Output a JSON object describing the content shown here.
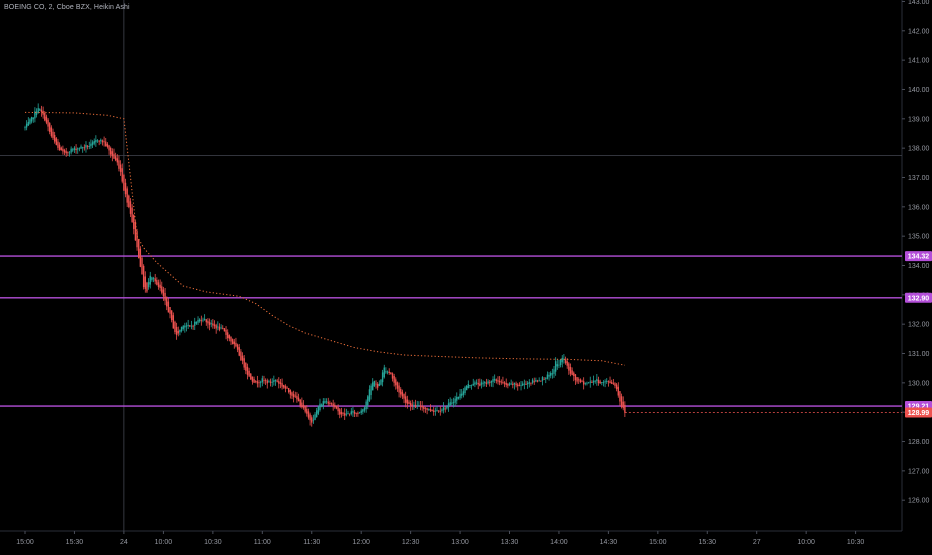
{
  "legend": {
    "symbol_line": "BOEING CO, 2, Cboe BZX, Heikin Ashi"
  },
  "colors": {
    "background": "#000000",
    "up": "#26a69a",
    "down": "#ef5350",
    "ma": "#f0703a",
    "level": "#b44fd9",
    "last_price": "#ef5350",
    "axis_text": "#9598a1",
    "crosshair": "#434651"
  },
  "chart_data": {
    "type": "candlestick",
    "title": "BOEING CO, 2, Cboe BZX, Heikin Ashi",
    "ylim": [
      124.95,
      143.05
    ],
    "y_ticks": [
      "126.00",
      "127.00",
      "128.00",
      "129.00",
      "130.00",
      "131.00",
      "132.00",
      "133.00",
      "134.00",
      "135.00",
      "136.00",
      "137.00",
      "138.00",
      "139.00",
      "140.00",
      "141.00",
      "142.00",
      "143.00"
    ],
    "time_range": [
      "15:00",
      "10:55 (day 27)"
    ],
    "x_ticks": [
      {
        "label": "15:00",
        "t": 0
      },
      {
        "label": "15:30",
        "t": 30
      },
      {
        "label": "24",
        "t": 60
      },
      {
        "label": "10:00",
        "t": 84
      },
      {
        "label": "10:30",
        "t": 114
      },
      {
        "label": "11:00",
        "t": 144
      },
      {
        "label": "11:30",
        "t": 174
      },
      {
        "label": "12:00",
        "t": 204
      },
      {
        "label": "12:30",
        "t": 234
      },
      {
        "label": "13:00",
        "t": 264
      },
      {
        "label": "13:30",
        "t": 294
      },
      {
        "label": "14:00",
        "t": 324
      },
      {
        "label": "14:30",
        "t": 354
      },
      {
        "label": "15:00",
        "t": 384
      },
      {
        "label": "15:30",
        "t": 414
      },
      {
        "label": "27",
        "t": 444
      },
      {
        "label": "10:00",
        "t": 474
      },
      {
        "label": "10:30",
        "t": 504
      }
    ],
    "session_break_t": 60,
    "crosshair_price": 137.75,
    "horizontal_levels": [
      {
        "value": 134.32,
        "label": "134.32"
      },
      {
        "value": 132.9,
        "label": "132.90"
      },
      {
        "value": 129.21,
        "label": "129.21"
      }
    ],
    "last_price": {
      "value": 128.99,
      "label": "128.99"
    },
    "price_path": [
      [
        0,
        138.7
      ],
      [
        4,
        139.0
      ],
      [
        8,
        139.4
      ],
      [
        12,
        139.0
      ],
      [
        16,
        138.4
      ],
      [
        20,
        138.0
      ],
      [
        24,
        137.8
      ],
      [
        28,
        137.95
      ],
      [
        32,
        138.0
      ],
      [
        36,
        138.05
      ],
      [
        40,
        138.1
      ],
      [
        44,
        138.3
      ],
      [
        48,
        138.2
      ],
      [
        52,
        137.8
      ],
      [
        56,
        137.5
      ],
      [
        58,
        137.2
      ],
      [
        60,
        136.6
      ],
      [
        62,
        136.2
      ],
      [
        64,
        135.8
      ],
      [
        66,
        135.2
      ],
      [
        68,
        134.6
      ],
      [
        70,
        134.0
      ],
      [
        72,
        133.3
      ],
      [
        74,
        133.1
      ],
      [
        76,
        133.7
      ],
      [
        78,
        133.6
      ],
      [
        80,
        133.3
      ],
      [
        82,
        133.2
      ],
      [
        84,
        132.9
      ],
      [
        86,
        132.6
      ],
      [
        88,
        132.3
      ],
      [
        90,
        131.9
      ],
      [
        92,
        131.6
      ],
      [
        96,
        132.0
      ],
      [
        100,
        131.9
      ],
      [
        104,
        132.1
      ],
      [
        108,
        132.2
      ],
      [
        112,
        132.0
      ],
      [
        116,
        131.9
      ],
      [
        120,
        131.8
      ],
      [
        124,
        131.5
      ],
      [
        128,
        131.2
      ],
      [
        132,
        130.7
      ],
      [
        136,
        130.2
      ],
      [
        140,
        130.0
      ],
      [
        144,
        130.1
      ],
      [
        148,
        130.0
      ],
      [
        152,
        130.1
      ],
      [
        156,
        129.9
      ],
      [
        160,
        129.7
      ],
      [
        164,
        129.5
      ],
      [
        168,
        129.2
      ],
      [
        172,
        128.8
      ],
      [
        174,
        128.7
      ],
      [
        176,
        128.9
      ],
      [
        178,
        129.2
      ],
      [
        182,
        129.4
      ],
      [
        186,
        129.3
      ],
      [
        190,
        129.0
      ],
      [
        194,
        128.9
      ],
      [
        198,
        129.0
      ],
      [
        202,
        128.95
      ],
      [
        206,
        129.2
      ],
      [
        210,
        129.9
      ],
      [
        212,
        130.1
      ],
      [
        214,
        129.8
      ],
      [
        218,
        130.5
      ],
      [
        222,
        130.3
      ],
      [
        224,
        130.0
      ],
      [
        228,
        129.6
      ],
      [
        232,
        129.3
      ],
      [
        236,
        129.2
      ],
      [
        240,
        129.2
      ],
      [
        244,
        129.1
      ],
      [
        248,
        129.05
      ],
      [
        252,
        129.1
      ],
      [
        256,
        129.2
      ],
      [
        260,
        129.4
      ],
      [
        264,
        129.6
      ],
      [
        268,
        129.9
      ],
      [
        272,
        130.0
      ],
      [
        276,
        129.95
      ],
      [
        280,
        130.0
      ],
      [
        284,
        130.1
      ],
      [
        288,
        130.05
      ],
      [
        292,
        129.9
      ],
      [
        296,
        129.95
      ],
      [
        300,
        129.9
      ],
      [
        304,
        130.0
      ],
      [
        308,
        130.05
      ],
      [
        312,
        130.1
      ],
      [
        316,
        130.2
      ],
      [
        320,
        130.3
      ],
      [
        322,
        130.7
      ],
      [
        324,
        130.6
      ],
      [
        326,
        130.9
      ],
      [
        328,
        130.7
      ],
      [
        330,
        130.4
      ],
      [
        334,
        130.1
      ],
      [
        338,
        130.0
      ],
      [
        342,
        130.0
      ],
      [
        346,
        130.1
      ],
      [
        350,
        130.0
      ],
      [
        354,
        130.05
      ],
      [
        358,
        129.95
      ],
      [
        360,
        129.6
      ],
      [
        362,
        129.2
      ],
      [
        364,
        129.0
      ]
    ],
    "moving_average": [
      [
        0,
        139.22
      ],
      [
        30,
        139.2
      ],
      [
        50,
        139.12
      ],
      [
        60,
        139.0
      ],
      [
        68,
        135.0
      ],
      [
        72,
        134.6
      ],
      [
        80,
        134.1
      ],
      [
        86,
        133.8
      ],
      [
        96,
        133.3
      ],
      [
        110,
        133.1
      ],
      [
        130,
        132.95
      ],
      [
        140,
        132.7
      ],
      [
        150,
        132.3
      ],
      [
        160,
        131.95
      ],
      [
        170,
        131.7
      ],
      [
        185,
        131.45
      ],
      [
        200,
        131.2
      ],
      [
        215,
        131.05
      ],
      [
        230,
        130.95
      ],
      [
        250,
        130.9
      ],
      [
        275,
        130.85
      ],
      [
        300,
        130.82
      ],
      [
        330,
        130.8
      ],
      [
        350,
        130.75
      ],
      [
        364,
        130.6
      ]
    ]
  }
}
